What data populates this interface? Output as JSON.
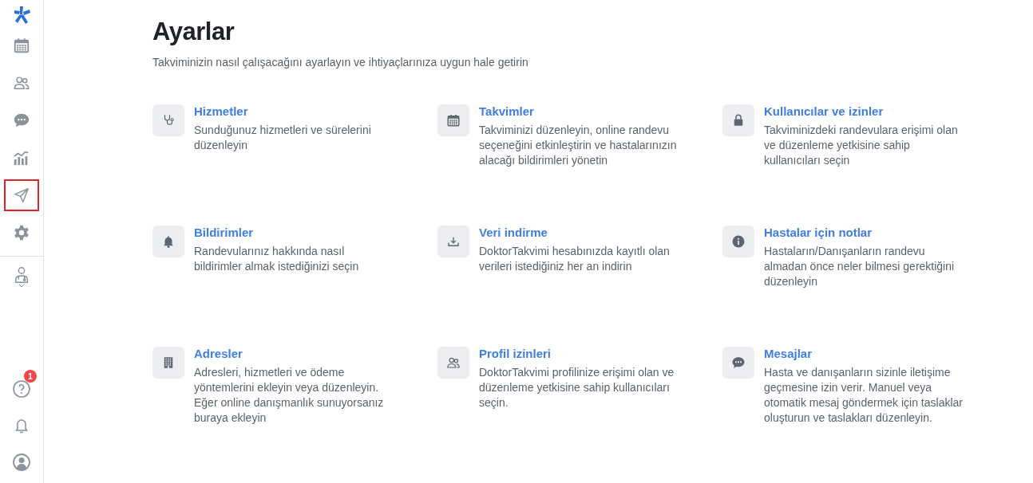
{
  "sidebar": {
    "top_items": [
      {
        "kind": "calendar",
        "highlighted": false
      },
      {
        "kind": "people",
        "highlighted": false
      },
      {
        "kind": "chat",
        "highlighted": false
      },
      {
        "kind": "chart",
        "highlighted": false
      },
      {
        "kind": "send",
        "highlighted": true
      },
      {
        "kind": "gear",
        "highlighted": false
      }
    ],
    "bottom_items": [
      {
        "kind": "help",
        "badge": "1"
      },
      {
        "kind": "bell"
      },
      {
        "kind": "user"
      }
    ]
  },
  "page": {
    "title": "Ayarlar",
    "subtitle": "Takviminizin nasıl çalışacağını ayarlayın ve ihtiyaçlarınıza uygun hale getirin"
  },
  "cards": [
    {
      "kind": "stethoscope",
      "title": "Hizmetler",
      "description": "Sunduğunuz hizmetleri ve sürelerini düzenleyin"
    },
    {
      "kind": "calendar",
      "title": "Takvimler",
      "description": "Takviminizi düzenleyin, online randevu seçeneğini etkinleştirin ve hastalarınızın alacağı bildirimleri yönetin"
    },
    {
      "kind": "lock",
      "title": "Kullanıcılar ve izinler",
      "description": "Takviminizdeki randevulara erişimi olan ve düzenleme yetkisine sahip kullanıcıları seçin"
    },
    {
      "kind": "bell",
      "title": "Bildirimler",
      "description": "Randevularınız hakkında nasıl bildirimler almak istediğinizi seçin"
    },
    {
      "kind": "download",
      "title": "Veri indirme",
      "description": "DoktorTakvimi hesabınızda kayıtlı olan verileri istediğiniz her an indirin"
    },
    {
      "kind": "info",
      "title": "Hastalar için notlar",
      "description": "Hastaların/Danışanların randevu almadan önce neler bilmesi gerektiğini düzenleyin"
    },
    {
      "kind": "building",
      "title": "Adresler",
      "description": "Adresleri, hizmetleri ve ödeme yöntemlerini ekleyin veya düzenleyin. Eğer online danışmanlık sunuyorsanız buraya ekleyin"
    },
    {
      "kind": "people",
      "title": "Profil izinleri",
      "description": "DoktorTakvimi profilinize erişimi olan ve düzenleme yetkisine sahip kullanıcıları seçin."
    },
    {
      "kind": "chat",
      "title": "Mesajlar",
      "description": "Hasta ve danışanların sizinle iletişime geçmesine izin verir. Manuel veya otomatik mesaj göndermek için taslaklar oluşturun ve taslakları düzenleyin."
    }
  ]
}
